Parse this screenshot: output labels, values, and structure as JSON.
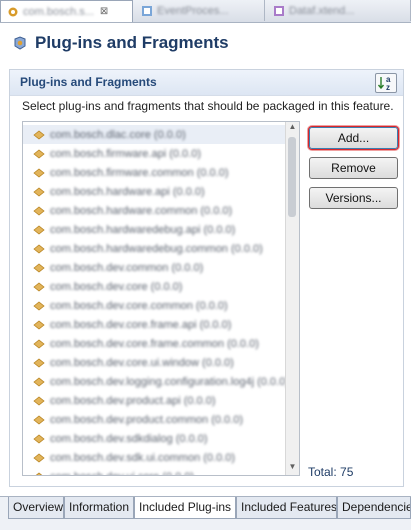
{
  "editor_tabs": [
    {
      "label": "com.bosch.s...",
      "active": true
    },
    {
      "label": "EventProces...",
      "active": false
    },
    {
      "label": "Dataf.xtend...",
      "active": false
    }
  ],
  "page": {
    "title": "Plug-ins and Fragments"
  },
  "section": {
    "title": "Plug-ins and Fragments",
    "description": "Select plug-ins and fragments that should be packaged in this feature.",
    "sort_icon": "sort-az-icon"
  },
  "plugins": [
    {
      "label": "com.bosch.dlac.core (0.0.0)"
    },
    {
      "label": "com.bosch.firmware.api (0.0.0)"
    },
    {
      "label": "com.bosch.firmware.common (0.0.0)"
    },
    {
      "label": "com.bosch.hardware.api (0.0.0)"
    },
    {
      "label": "com.bosch.hardware.common (0.0.0)"
    },
    {
      "label": "com.bosch.hardwaredebug.api (0.0.0)"
    },
    {
      "label": "com.bosch.hardwaredebug.common (0.0.0)"
    },
    {
      "label": "com.bosch.dev.common (0.0.0)"
    },
    {
      "label": "com.bosch.dev.core (0.0.0)"
    },
    {
      "label": "com.bosch.dev.core.common (0.0.0)"
    },
    {
      "label": "com.bosch.dev.core.frame.api (0.0.0)"
    },
    {
      "label": "com.bosch.dev.core.frame.common (0.0.0)"
    },
    {
      "label": "com.bosch.dev.core.ui.window (0.0.0)"
    },
    {
      "label": "com.bosch.dev.logging.configuration.log4j (0.0.0)"
    },
    {
      "label": "com.bosch.dev.product.api (0.0.0)"
    },
    {
      "label": "com.bosch.dev.product.common (0.0.0)"
    },
    {
      "label": "com.bosch.dev.sdkdialog (0.0.0)"
    },
    {
      "label": "com.bosch.dev.sdk.ui.common (0.0.0)"
    },
    {
      "label": "com.bosch.dev.ui.core (0.0.0)"
    }
  ],
  "buttons": {
    "add": "Add...",
    "remove": "Remove",
    "versions": "Versions..."
  },
  "total": "Total: 75",
  "bottom_tabs": [
    {
      "label": "Overview"
    },
    {
      "label": "Information"
    },
    {
      "label": "Included Plug-ins",
      "active": true
    },
    {
      "label": "Included Features"
    },
    {
      "label": "Dependencies"
    }
  ]
}
